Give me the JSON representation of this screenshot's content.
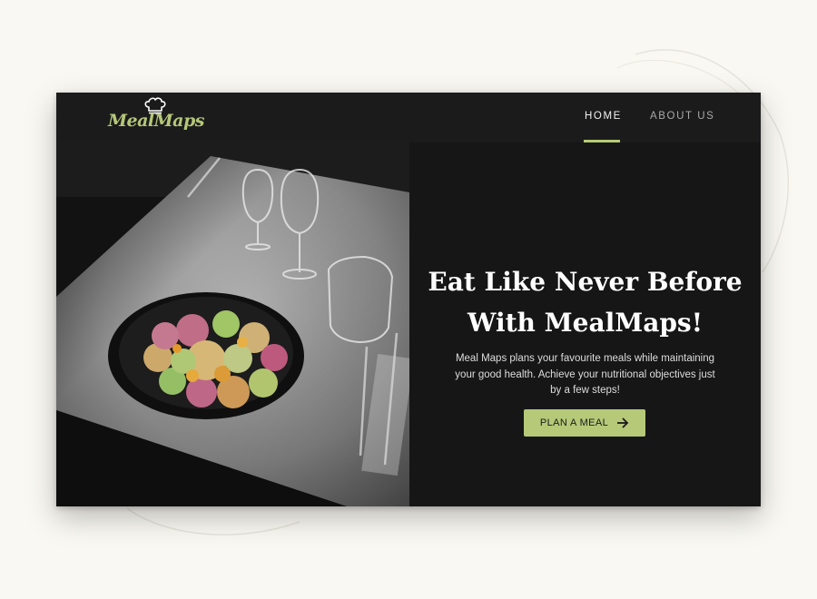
{
  "brand": {
    "name": "MealMaps",
    "accent_color": "#b5c978",
    "logo_icon": "chef-hat-icon"
  },
  "nav": {
    "items": [
      {
        "label": "HOME",
        "active": true
      },
      {
        "label": "ABOUT US",
        "active": false
      }
    ]
  },
  "hero": {
    "headline_line1": "Eat Like Never Before",
    "headline_line2": "With MealMaps!",
    "subtext": "Meal Maps plans your favourite meals while maintaining your good health. Achieve your nutritional objectives just by a few steps!",
    "cta": {
      "label": "PLAN A MEAL",
      "icon": "arrow-right-icon"
    }
  },
  "colors": {
    "page_bg": "#f9f8f2",
    "frame_bg": "#161617",
    "nav_bg": "#1b1b1c"
  }
}
